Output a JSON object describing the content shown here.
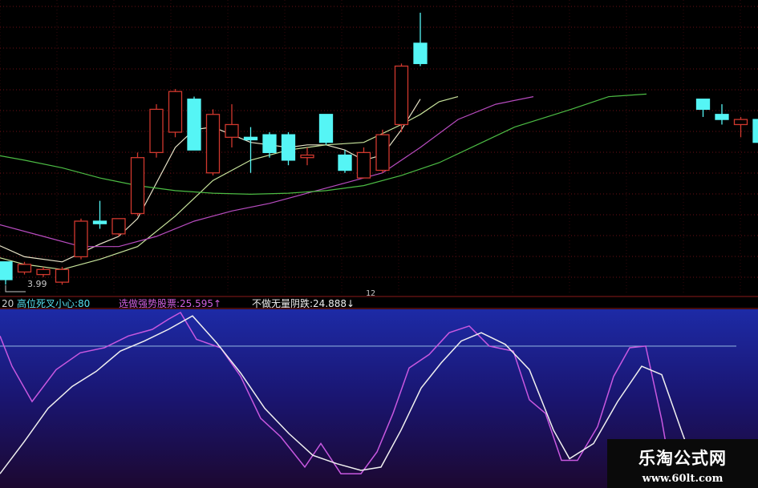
{
  "chart_data": [
    {
      "type": "candlestick",
      "title": "",
      "ylim": [
        3.8,
        9.6
      ],
      "grid": true,
      "colors": {
        "up": "#d0382e",
        "down": "#55f5f5",
        "grid": "#6b0f16",
        "ma_fast": "#e8e4c8",
        "ma_mid": "#c8e49c",
        "ma_slow": "#b84cc0",
        "ma_long": "#4cbc44"
      },
      "candles": [
        {
          "o": 4.45,
          "h": 4.45,
          "l": 4.0,
          "c": 4.1
        },
        {
          "o": 4.25,
          "h": 4.45,
          "l": 4.2,
          "c": 4.4
        },
        {
          "o": 4.2,
          "h": 4.35,
          "l": 4.15,
          "c": 4.3
        },
        {
          "o": 4.05,
          "h": 4.35,
          "l": 4.0,
          "c": 4.3
        },
        {
          "o": 4.55,
          "h": 5.3,
          "l": 4.5,
          "c": 5.25
        },
        {
          "o": 5.25,
          "h": 5.65,
          "l": 5.1,
          "c": 5.2
        },
        {
          "o": 5.0,
          "h": 5.3,
          "l": 4.95,
          "c": 5.3
        },
        {
          "o": 5.4,
          "h": 6.6,
          "l": 5.35,
          "c": 6.5
        },
        {
          "o": 6.6,
          "h": 7.55,
          "l": 6.5,
          "c": 7.45
        },
        {
          "o": 7.0,
          "h": 7.85,
          "l": 6.9,
          "c": 7.8
        },
        {
          "o": 7.65,
          "h": 7.7,
          "l": 6.65,
          "c": 6.65
        },
        {
          "o": 6.2,
          "h": 7.45,
          "l": 6.15,
          "c": 7.35
        },
        {
          "o": 6.9,
          "h": 7.55,
          "l": 6.7,
          "c": 7.15
        },
        {
          "o": 6.9,
          "h": 7.1,
          "l": 6.2,
          "c": 6.85
        },
        {
          "o": 6.95,
          "h": 7.0,
          "l": 6.5,
          "c": 6.6
        },
        {
          "o": 6.95,
          "h": 7.0,
          "l": 6.35,
          "c": 6.45
        },
        {
          "o": 6.5,
          "h": 6.7,
          "l": 6.35,
          "c": 6.55
        },
        {
          "o": 7.35,
          "h": 7.35,
          "l": 6.75,
          "c": 6.8
        },
        {
          "o": 6.55,
          "h": 6.65,
          "l": 6.2,
          "c": 6.25
        },
        {
          "o": 6.1,
          "h": 6.7,
          "l": 6.1,
          "c": 6.6
        },
        {
          "o": 6.25,
          "h": 7.05,
          "l": 6.2,
          "c": 6.95
        },
        {
          "o": 7.15,
          "h": 8.35,
          "l": 7.0,
          "c": 8.3
        },
        {
          "o": 8.75,
          "h": 9.35,
          "l": 8.3,
          "c": 8.35
        },
        null,
        null,
        null,
        null,
        null,
        null,
        null,
        null,
        null,
        null,
        null,
        null,
        null,
        null,
        {
          "o": 7.65,
          "h": 7.65,
          "l": 7.3,
          "c": 7.45
        },
        {
          "o": 7.35,
          "h": 7.55,
          "l": 7.15,
          "c": 7.25
        },
        {
          "o": 7.15,
          "h": 7.3,
          "l": 6.9,
          "c": 7.25
        },
        {
          "o": 7.25,
          "h": 7.4,
          "l": 6.55,
          "c": 6.8
        }
      ],
      "ma_lines": [
        {
          "key": "ma_fast",
          "points": [
            [
              -0.5,
              4.8
            ],
            [
              1,
              4.55
            ],
            [
              3,
              4.45
            ],
            [
              5,
              4.8
            ],
            [
              6,
              4.95
            ],
            [
              7,
              5.3
            ],
            [
              8,
              6.0
            ],
            [
              9,
              6.7
            ],
            [
              10,
              7.05
            ],
            [
              11,
              7.1
            ],
            [
              12,
              6.95
            ],
            [
              13,
              6.8
            ],
            [
              14,
              6.75
            ],
            [
              15,
              6.7
            ],
            [
              16,
              6.75
            ],
            [
              17,
              6.75
            ],
            [
              18,
              6.65
            ],
            [
              19,
              6.45
            ],
            [
              20,
              6.55
            ],
            [
              21,
              7.05
            ],
            [
              22,
              7.65
            ]
          ]
        },
        {
          "key": "ma_mid",
          "points": [
            [
              -0.5,
              4.55
            ],
            [
              1,
              4.4
            ],
            [
              3,
              4.3
            ],
            [
              5,
              4.5
            ],
            [
              7,
              4.75
            ],
            [
              9,
              5.35
            ],
            [
              11,
              6.05
            ],
            [
              13,
              6.45
            ],
            [
              15,
              6.65
            ],
            [
              17,
              6.75
            ],
            [
              19,
              6.8
            ],
            [
              21,
              7.15
            ],
            [
              22,
              7.35
            ],
            [
              23,
              7.6
            ],
            [
              24,
              7.7
            ]
          ]
        },
        {
          "key": "ma_slow",
          "points": [
            [
              -0.5,
              5.2
            ],
            [
              2,
              4.95
            ],
            [
              4,
              4.75
            ],
            [
              6,
              4.75
            ],
            [
              8,
              4.95
            ],
            [
              10,
              5.25
            ],
            [
              12,
              5.45
            ],
            [
              14,
              5.6
            ],
            [
              16,
              5.8
            ],
            [
              18,
              6.0
            ],
            [
              20,
              6.2
            ],
            [
              22,
              6.7
            ],
            [
              24,
              7.25
            ],
            [
              26,
              7.55
            ],
            [
              28,
              7.7
            ]
          ]
        },
        {
          "key": "ma_long",
          "points": [
            [
              -0.5,
              6.55
            ],
            [
              1,
              6.45
            ],
            [
              3,
              6.3
            ],
            [
              5,
              6.1
            ],
            [
              7,
              5.95
            ],
            [
              9,
              5.85
            ],
            [
              11,
              5.8
            ],
            [
              13,
              5.78
            ],
            [
              15,
              5.8
            ],
            [
              17,
              5.85
            ],
            [
              19,
              5.95
            ],
            [
              21,
              6.15
            ],
            [
              23,
              6.4
            ],
            [
              25,
              6.75
            ],
            [
              27,
              7.1
            ],
            [
              30,
              7.45
            ],
            [
              32,
              7.7
            ],
            [
              34,
              7.75
            ]
          ]
        }
      ],
      "low_marker": {
        "index": 0,
        "value": 3.99,
        "label": "3.99"
      },
      "axis_tick": "12"
    },
    {
      "type": "line",
      "title": "",
      "ylim": [
        0,
        100
      ],
      "reference_line": 80,
      "colors": {
        "fast": "#c858e0",
        "slow": "#f0f0f0",
        "ref": "#86a8d8"
      },
      "x": [
        0,
        920
      ],
      "series": [
        {
          "key": "fast",
          "points": [
            [
              0,
              86
            ],
            [
              15,
              68
            ],
            [
              40,
              47
            ],
            [
              70,
              66
            ],
            [
              100,
              76
            ],
            [
              130,
              79
            ],
            [
              160,
              86
            ],
            [
              190,
              90
            ],
            [
              210,
              96
            ],
            [
              225,
              100
            ],
            [
              245,
              84
            ],
            [
              275,
              79
            ],
            [
              300,
              62
            ],
            [
              325,
              37
            ],
            [
              350,
              26
            ],
            [
              380,
              8
            ],
            [
              400,
              22
            ],
            [
              425,
              4
            ],
            [
              450,
              4
            ],
            [
              470,
              17
            ],
            [
              490,
              40
            ],
            [
              510,
              67
            ],
            [
              535,
              75
            ],
            [
              560,
              88
            ],
            [
              585,
              92
            ],
            [
              610,
              80
            ],
            [
              640,
              77
            ],
            [
              660,
              48
            ],
            [
              680,
              40
            ],
            [
              700,
              12
            ],
            [
              720,
              12
            ],
            [
              745,
              32
            ],
            [
              765,
              62
            ],
            [
              785,
              79
            ],
            [
              805,
              80
            ],
            [
              825,
              36
            ],
            [
              840,
              -5
            ]
          ]
        },
        {
          "key": "slow",
          "points": [
            [
              0,
              4
            ],
            [
              30,
              23
            ],
            [
              60,
              43
            ],
            [
              90,
              56
            ],
            [
              120,
              65
            ],
            [
              150,
              77
            ],
            [
              180,
              83
            ],
            [
              210,
              90
            ],
            [
              240,
              98
            ],
            [
              270,
              82
            ],
            [
              300,
              64
            ],
            [
              330,
              43
            ],
            [
              360,
              28
            ],
            [
              390,
              15
            ],
            [
              420,
              10
            ],
            [
              450,
              6
            ],
            [
              475,
              8
            ],
            [
              500,
              30
            ],
            [
              525,
              55
            ],
            [
              550,
              70
            ],
            [
              575,
              83
            ],
            [
              600,
              88
            ],
            [
              630,
              81
            ],
            [
              660,
              66
            ],
            [
              690,
              30
            ],
            [
              710,
              13
            ],
            [
              740,
              22
            ],
            [
              770,
              47
            ],
            [
              800,
              68
            ],
            [
              825,
              63
            ],
            [
              850,
              29
            ],
            [
              870,
              3
            ]
          ]
        }
      ]
    }
  ],
  "labels": {
    "prefix": "20",
    "item1": "高位死叉小心:80",
    "item2": "选做强势股票:25.595↑",
    "item3": "不做无量阴跌:24.888↓"
  },
  "watermark": {
    "title": "乐淘公式网",
    "url": "www.60lt.com"
  }
}
